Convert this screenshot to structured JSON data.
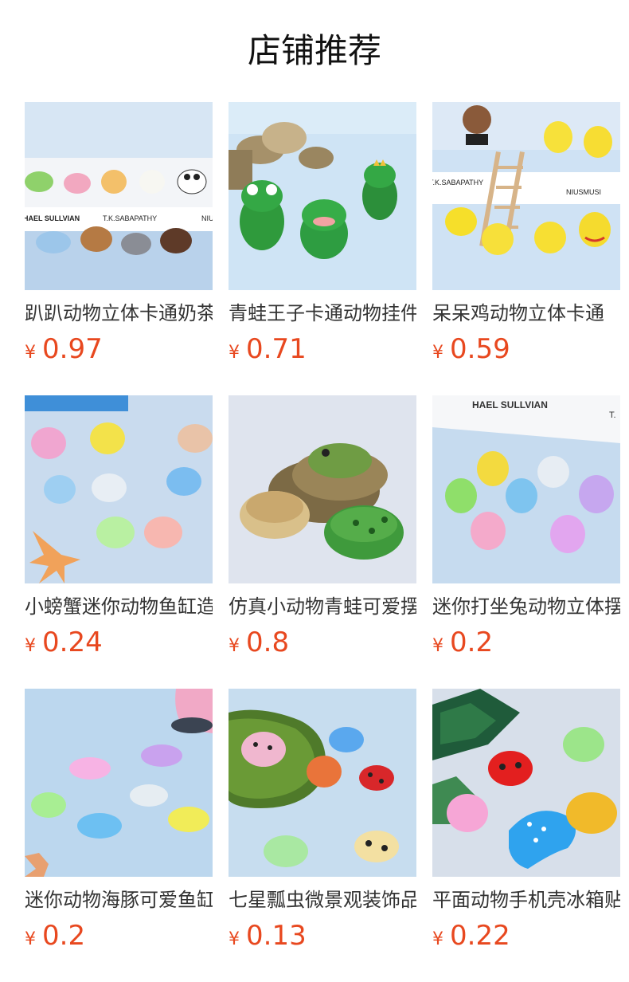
{
  "header": {
    "title": "店铺推荐"
  },
  "products": [
    {
      "name": "趴趴动物立体卡通奶茶",
      "currency": "¥",
      "price": "0.97",
      "image": "lying-animals-image",
      "scene": "animals"
    },
    {
      "name": "青蛙王子卡通动物挂件",
      "currency": "¥",
      "price": "0.71",
      "image": "frog-prince-image",
      "scene": "frogs"
    },
    {
      "name": "呆呆鸡动物立体卡通",
      "currency": "¥",
      "price": "0.59",
      "image": "chicks-image",
      "scene": "chicks"
    },
    {
      "name": "小螃蟹迷你动物鱼缸造景",
      "currency": "¥",
      "price": "0.24",
      "image": "crabs-image",
      "scene": "crabs"
    },
    {
      "name": "仿真小动物青蛙可爱摆件",
      "currency": "¥",
      "price": "0.8",
      "image": "realistic-frogs-image",
      "scene": "toads"
    },
    {
      "name": "迷你打坐兔动物立体摆件",
      "currency": "¥",
      "price": "0.2",
      "image": "rabbits-image",
      "scene": "rabbits"
    },
    {
      "name": "迷你动物海豚可爱鱼缸",
      "currency": "¥",
      "price": "0.2",
      "image": "dolphins-image",
      "scene": "dolphins"
    },
    {
      "name": "七星瓢虫微景观装饰品",
      "currency": "¥",
      "price": "0.13",
      "image": "ladybugs-image",
      "scene": "ladybugs"
    },
    {
      "name": "平面动物手机壳冰箱贴",
      "currency": "¥",
      "price": "0.22",
      "image": "flat-animals-image",
      "scene": "flat"
    }
  ],
  "scene_text": {
    "animals_card_1": "HAEL SULLVIAN",
    "animals_card_2": "T.K.SABAPATHY",
    "animals_card_3": "NIU",
    "chicks_card_1": "T.K.SABAPATHY",
    "chicks_card_2": "NIUSMUSI",
    "rabbits_card_1": "HAEL SULLVIAN",
    "rabbits_card_2": "T."
  },
  "colors": {
    "price": "#e8481f",
    "title": "#111111",
    "name": "#333333",
    "bg": "#ffffff"
  }
}
